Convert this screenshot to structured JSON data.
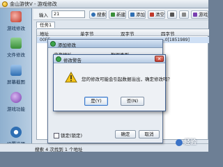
{
  "window": {
    "title": "金山游侠V - 游戏修改"
  },
  "sidebar": {
    "items": [
      {
        "label": "游戏修改",
        "icon": "joystick-icon",
        "color": "#c0392b"
      },
      {
        "label": "文件修改",
        "icon": "folder-icon",
        "color": "#3a8f3a"
      },
      {
        "label": "屏幕截图",
        "icon": "camera-icon",
        "color": "#2f6fb3"
      },
      {
        "label": "游戏功能",
        "icon": "ball-icon",
        "color": "#7a3fb0"
      },
      {
        "label": "设置选项",
        "icon": "gear-icon",
        "color": "#2f6fb3"
      }
    ]
  },
  "toolbar": {
    "input_label": "输入",
    "input_value": "21",
    "search": "搜索",
    "new": "新建",
    "add": "添加",
    "clear": "清空",
    "clear_icon_color": "#c0392b",
    "game": "游戏"
  },
  "tabs": [
    {
      "label": "任务1"
    }
  ],
  "grid": {
    "columns": [
      "地址",
      "单字节",
      "双字节",
      "四字节"
    ],
    "rows": [
      [
        "00FE...",
        "...",
        "...",
        "...0[1851989]"
      ]
    ]
  },
  "edit_dialog": {
    "title": "添加修改",
    "fields": [
      "内存地址",
      "数据类型"
    ],
    "checkbox_label": "锁定(锁定)",
    "ok": "确定",
    "cancel": "取消"
  },
  "warn_dialog": {
    "title": "修改警告",
    "message": "您的修改可能会引起数据溢出，确定修改吗？",
    "yes": "是(Y)",
    "no": "否(N)"
  },
  "status": {
    "text": "搜索 4 次找到 1 个地址"
  },
  "watermark": {
    "text": "经验"
  }
}
